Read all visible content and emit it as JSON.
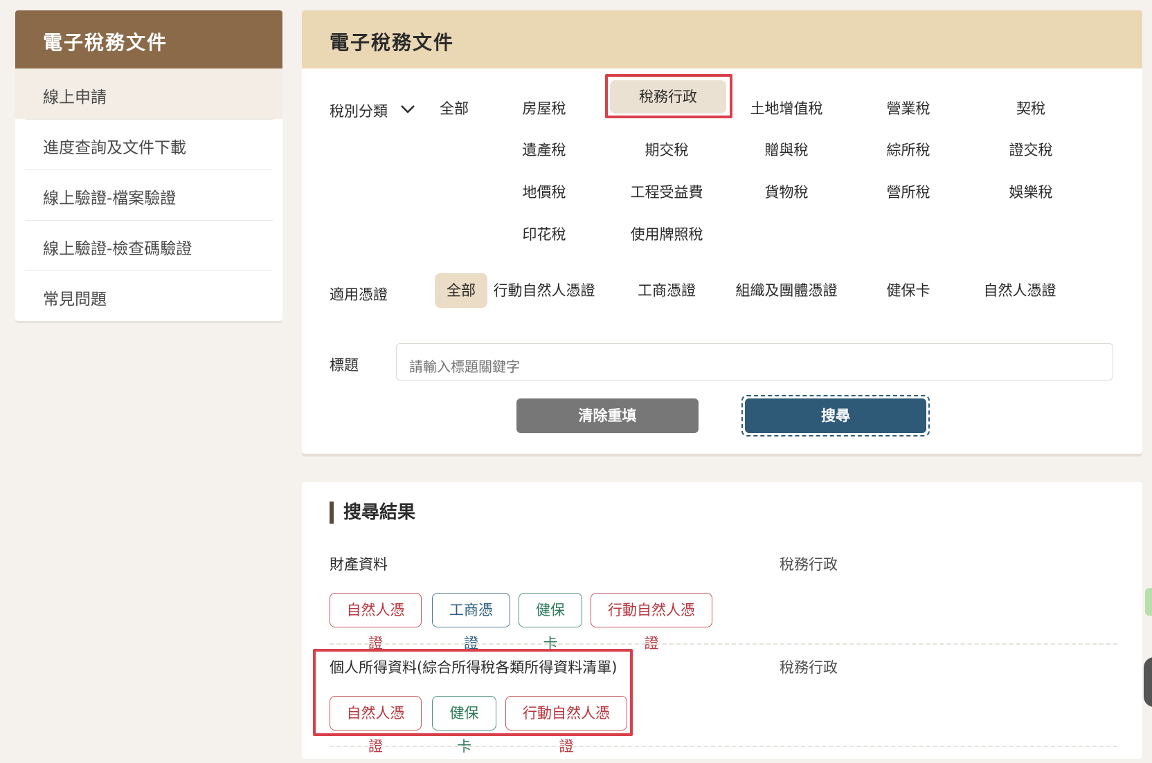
{
  "sidebar": {
    "title": "電子稅務文件",
    "items": [
      {
        "label": "線上申請"
      },
      {
        "label": "進度查詢及文件下載"
      },
      {
        "label": "線上驗證-檔案驗證"
      },
      {
        "label": "線上驗證-檢查碼驗證"
      },
      {
        "label": "常見問題"
      }
    ]
  },
  "panel": {
    "title": "電子稅務文件",
    "tax_label": "稅別分類",
    "tax_all": "全部",
    "tax_options": [
      "房屋稅",
      "稅務行政",
      "土地增值稅",
      "營業稅",
      "契稅",
      "遺產稅",
      "期交稅",
      "贈與稅",
      "綜所稅",
      "證交稅",
      "地價稅",
      "工程受益費",
      "貨物稅",
      "營所稅",
      "娛樂稅",
      "印花稅",
      "使用牌照稅"
    ],
    "cert_label": "適用憑證",
    "cert_options": [
      "全部",
      "行動自然人憑證",
      "工商憑證",
      "組織及團體憑證",
      "健保卡",
      "自然人憑證"
    ],
    "title_label": "標題",
    "title_placeholder": "請輸入標題關鍵字",
    "clear_button": "清除重填",
    "search_button": "搜尋"
  },
  "results": {
    "heading": "搜尋結果",
    "items": [
      {
        "name": "財產資料",
        "category": "稅務行政",
        "tags": [
          "自然人憑證",
          "工商憑證",
          "健保卡",
          "行動自然人憑證"
        ]
      },
      {
        "name": "個人所得資料(綜合所得稅各類所得資料清單)",
        "category": "稅務行政",
        "tags": [
          "自然人憑證",
          "健保卡",
          "行動自然人憑證"
        ]
      }
    ]
  },
  "colors": {
    "sidebar_header": "#8a6a49",
    "panel_header": "#ead8b5",
    "search_button": "#2e5a78",
    "clear_button": "#777777",
    "highlight_box": "#d9404a"
  }
}
